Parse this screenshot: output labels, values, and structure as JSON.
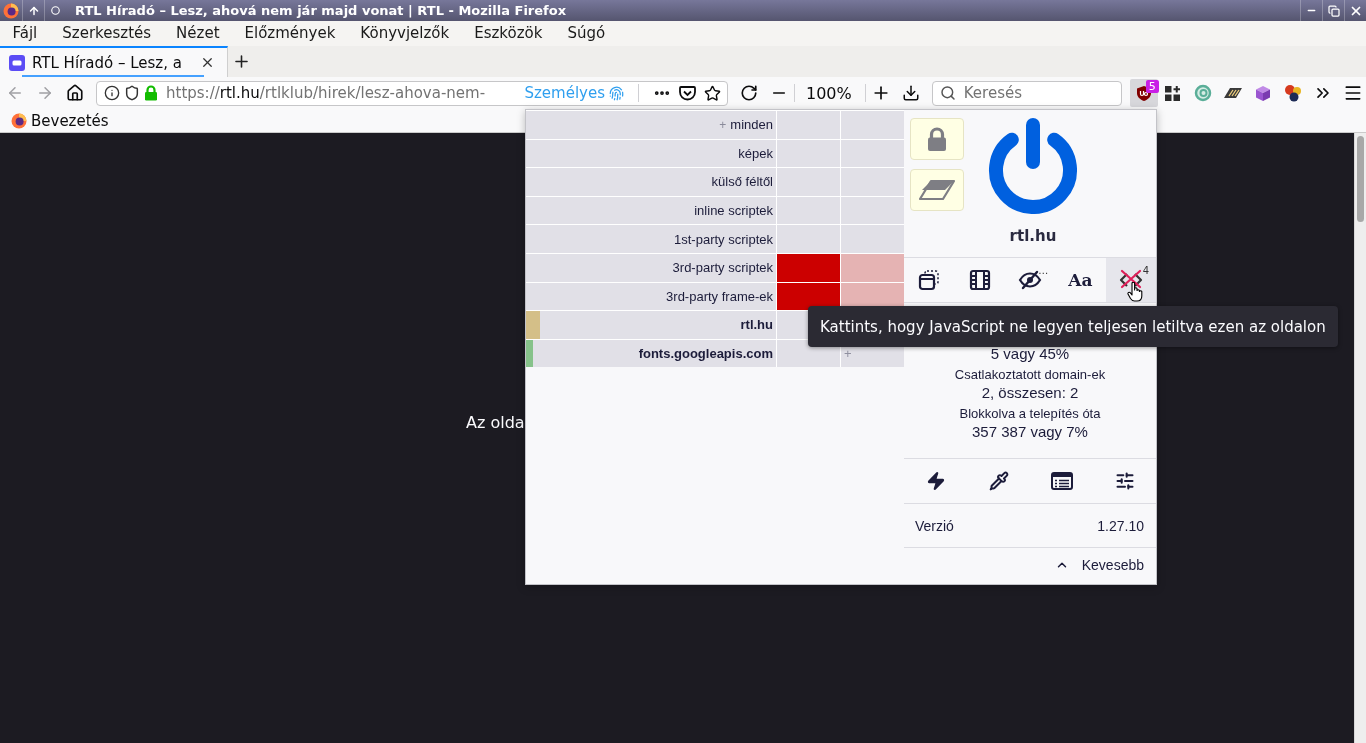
{
  "window": {
    "title": "RTL Híradó – Lesz, ahová nem jár majd vonat | RTL - Mozilla Firefox"
  },
  "menu": [
    {
      "label": "Fájl"
    },
    {
      "label": "Szerkesztés"
    },
    {
      "label": "Nézet"
    },
    {
      "label": "Előzmények"
    },
    {
      "label": "Könyvjelzők"
    },
    {
      "label": "Eszközök"
    },
    {
      "label": "Súgó"
    }
  ],
  "tabs": [
    {
      "title": "RTL Híradó – Lesz, a",
      "selected": true
    }
  ],
  "navbar": {
    "url": "https://**rtl.hu**/rtlklub/hirek/lesz-ahova-nem-",
    "container": "Személyes",
    "zoom": "100%",
    "search": {
      "placeholder": "Keresés"
    },
    "blocker_button": {
      "badge": "5",
      "pressed": true
    }
  },
  "bookmarks": [
    {
      "label": "Bevezetés"
    }
  ],
  "page": {
    "text": "Az olda"
  },
  "popup": {
    "rules": [
      {
        "kind": "type",
        "toggle": "+",
        "label": "minden",
        "blocked": false
      },
      {
        "kind": "type",
        "label": "képek",
        "blocked": false
      },
      {
        "kind": "type",
        "label": "külső féltől",
        "blocked": false
      },
      {
        "kind": "type",
        "label": "inline scriptek",
        "blocked": false
      },
      {
        "kind": "type",
        "label": "1st-party scriptek",
        "blocked": false
      },
      {
        "kind": "type",
        "label": "3rd-party scriptek",
        "blocked": true
      },
      {
        "kind": "type",
        "label": "3rd-party frame-ek",
        "blocked": true
      },
      {
        "kind": "domain",
        "label": "rtl.hu",
        "color": "#d4bf88",
        "level": 0.056,
        "blocked": false
      },
      {
        "kind": "domain",
        "label": "fonts.googleapis.com",
        "color": "#86c28a",
        "level": 0.028,
        "blocked": false,
        "local_hint": "+"
      }
    ],
    "unsaved_changes": true,
    "power": {
      "enabled": true
    },
    "hostname": "rtl.hu",
    "switches": [
      {
        "kind": "popups",
        "on": false,
        "hovered": false
      },
      {
        "kind": "media",
        "on": false,
        "hovered": false
      },
      {
        "kind": "cosmetic",
        "on": false,
        "hovered": false,
        "badge": "…"
      },
      {
        "kind": "fonts",
        "on": false,
        "hovered": false,
        "glyph": "Aa"
      },
      {
        "kind": "scripts",
        "on": true,
        "hovered": true,
        "badge": "4"
      }
    ],
    "stats": [
      {
        "value": "5 vagy 45%"
      },
      {
        "label": "Csatlakoztatott domain-ek",
        "value": "2, összesen: 2"
      },
      {
        "label": "Blokkolva a telepítés óta",
        "value": "357 387 vagy 7%"
      }
    ],
    "version": {
      "label": "Verzió",
      "value": "1.27.10"
    },
    "collapse": {
      "label": "Kevesebb"
    }
  },
  "tooltip": {
    "text": "Kattints, hogy JavaScript ne legyen teljesen letiltva ezen az oldalon"
  }
}
